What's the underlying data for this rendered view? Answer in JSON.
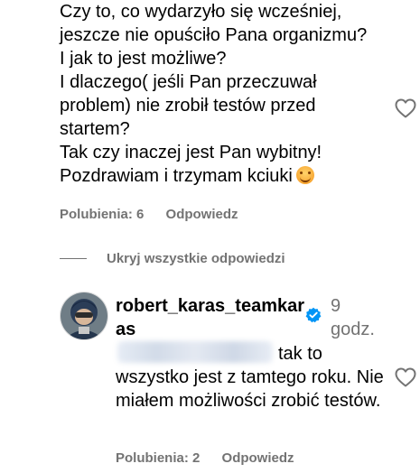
{
  "comment": {
    "lines": [
      "Czy to, co wydarzyło się wcześniej,",
      "jeszcze nie opuściło Pana organizmu?",
      "I jak to jest możliwe?",
      "I dlaczego( jeśli Pan przeczuwał",
      "problem) nie zrobił testów przed",
      "startem?",
      "Tak czy inaczej jest Pan wybitny!",
      "Pozdrawiam i trzymam kciuki"
    ],
    "emoji": "smiling-face-icon",
    "likes_label": "Polubienia: 6",
    "reply_label": "Odpowiedz"
  },
  "thread": {
    "hide_replies_label": "Ukryj wszystkie odpowiedzi"
  },
  "reply": {
    "username": "robert_karas_teamkaras",
    "verified": true,
    "timestamp": "9 godz.",
    "text_line1": "tak to",
    "text_rest": "wszystko jest z tamtego roku. Nie miałem możliwości zrobić testów.",
    "likes_label": "Polubienia: 2",
    "reply_label": "Odpowiedz"
  },
  "colors": {
    "text": "#000000",
    "secondary": "#737373",
    "verified": "#0095f6"
  }
}
